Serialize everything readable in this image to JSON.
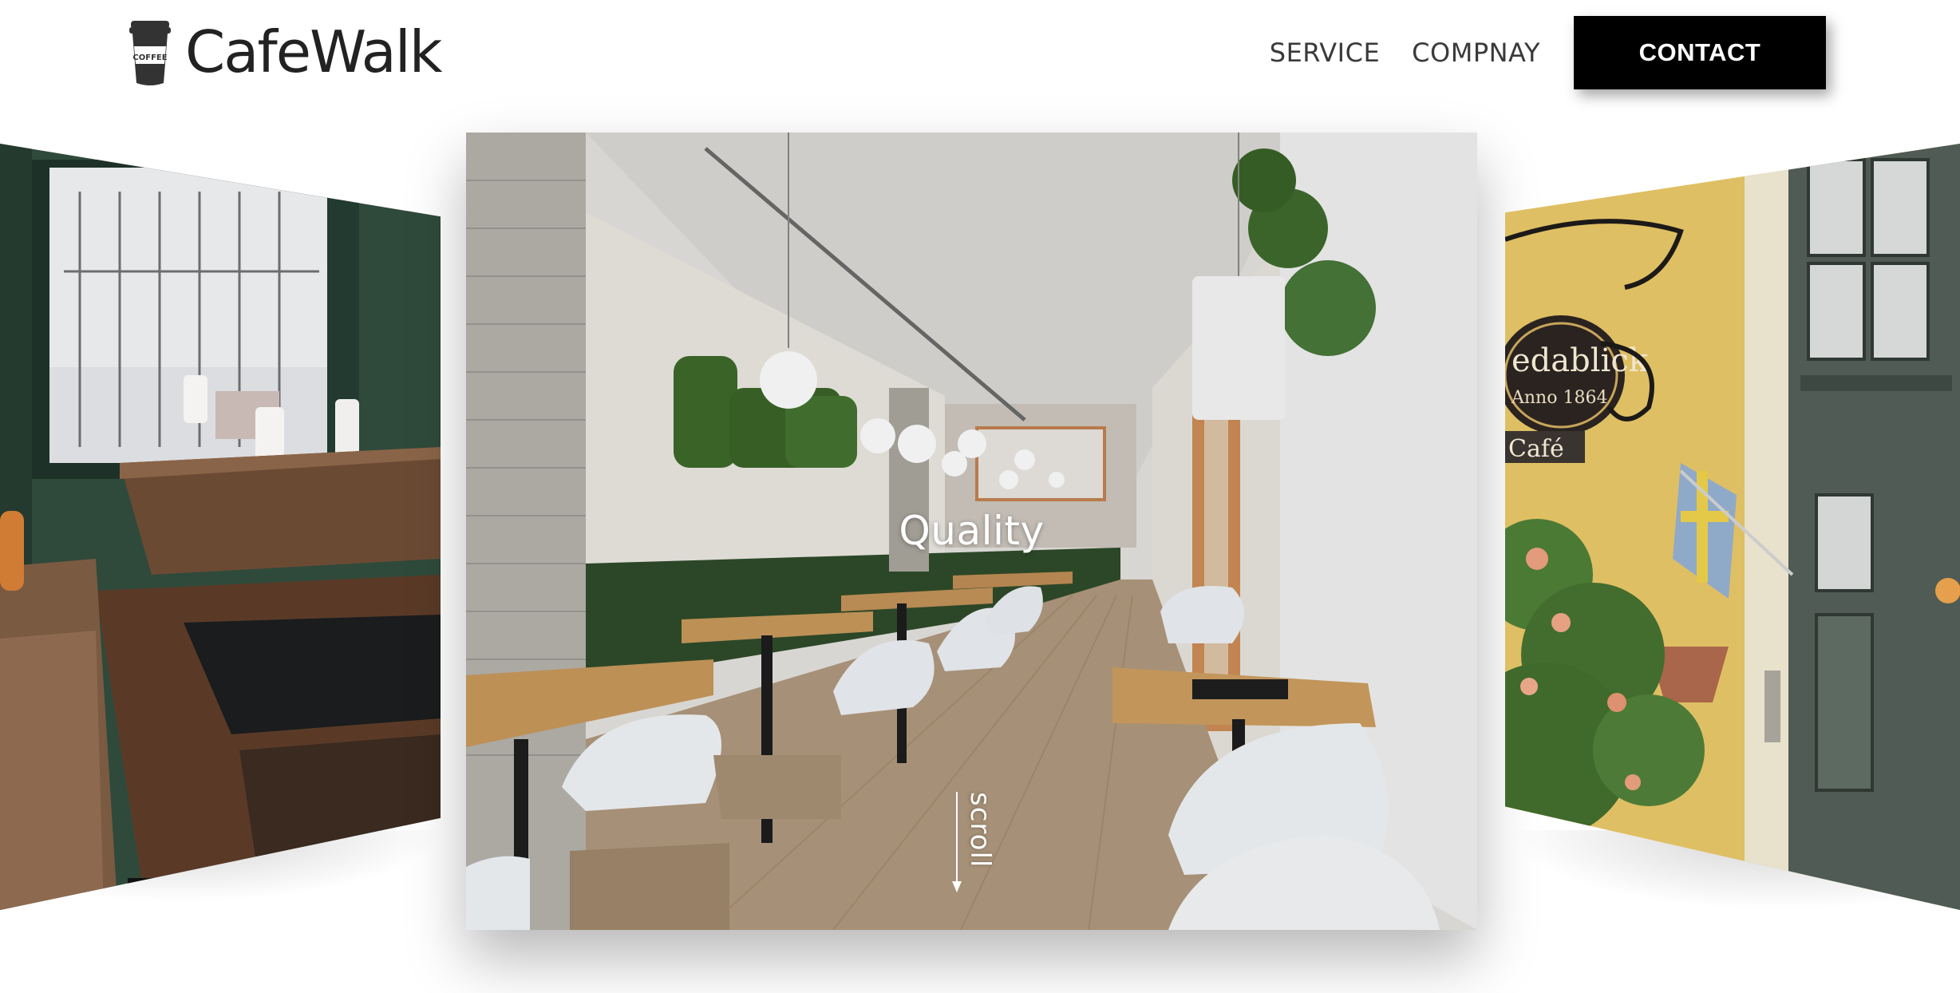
{
  "brand": {
    "name": "CafeWalk",
    "icon": "coffee-cup-icon",
    "cup_label": "COFFEE"
  },
  "nav": {
    "items": [
      {
        "label": "SERVICE"
      },
      {
        "label": "COMPNAY"
      }
    ],
    "contact_label": "CONTACT"
  },
  "carousel": {
    "active_caption": "Quality",
    "scroll_label": "scroll",
    "right_slide_sign": {
      "name": "edablick",
      "year": "Anno 1864",
      "subtitle": "Café"
    }
  },
  "colors": {
    "accent": "#000000",
    "text": "#222222",
    "nav_text": "#3a3a3a",
    "background": "#ffffff"
  }
}
